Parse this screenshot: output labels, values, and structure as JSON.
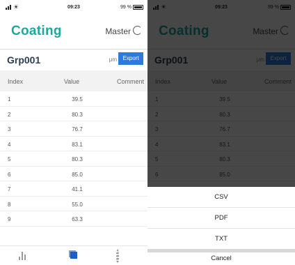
{
  "status_bar": {
    "time": "09:23",
    "battery": "99 %"
  },
  "header": {
    "logo": "Coating",
    "master_label": "Master"
  },
  "group": {
    "name": "Grp001",
    "unit": "μm",
    "export_label": "Export"
  },
  "table": {
    "columns": [
      "Index",
      "Value",
      "Comment"
    ],
    "rows": [
      {
        "index": "1",
        "value": "39.5",
        "comment": ""
      },
      {
        "index": "2",
        "value": "80.3",
        "comment": ""
      },
      {
        "index": "3",
        "value": "76.7",
        "comment": ""
      },
      {
        "index": "4",
        "value": "83.1",
        "comment": ""
      },
      {
        "index": "5",
        "value": "80.3",
        "comment": ""
      },
      {
        "index": "6",
        "value": "85.0",
        "comment": ""
      },
      {
        "index": "7",
        "value": "41.1",
        "comment": ""
      },
      {
        "index": "8",
        "value": "55.0",
        "comment": ""
      },
      {
        "index": "9",
        "value": "63.3",
        "comment": ""
      }
    ]
  },
  "tabs": [
    {
      "icon": "bar-chart-icon"
    },
    {
      "icon": "document-icon"
    },
    {
      "icon": "gear-icon"
    }
  ],
  "export_sheet": {
    "options": [
      "CSV",
      "PDF",
      "TXT"
    ],
    "cancel_label": "Cancel"
  },
  "colors": {
    "brand": "#1fa89a",
    "export_button": "#2e7be0"
  }
}
